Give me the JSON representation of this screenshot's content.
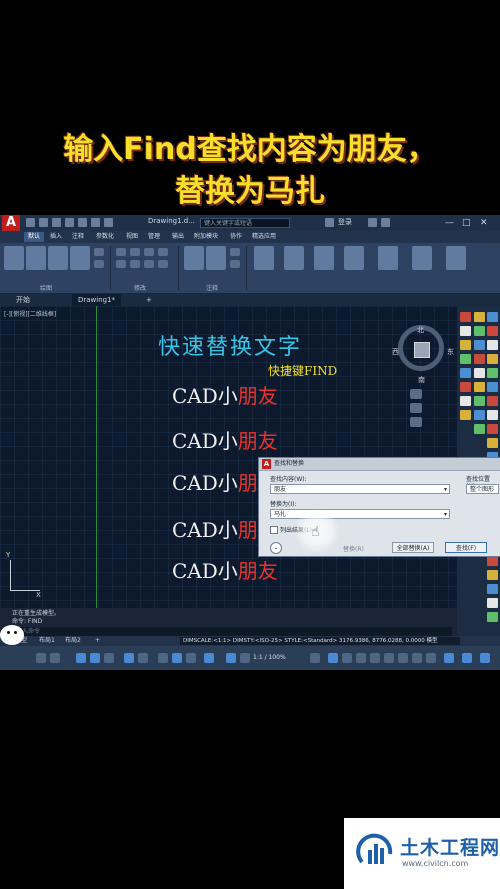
{
  "headline": {
    "line1": "输入Find查找内容为朋友，",
    "line2": "替换为马扎"
  },
  "titlebar": {
    "doc_title": "Drawing1.d...",
    "search_placeholder": "键入关键字或短语",
    "login": "登录",
    "minimize": "—",
    "maximize": "□",
    "close": "✕"
  },
  "menu": [
    "默认",
    "插入",
    "注释",
    "参数化",
    "视图",
    "管理",
    "输出",
    "附加模块",
    "协作",
    "精选应用"
  ],
  "ribbon": {
    "groups": [
      "绘图",
      "修改",
      "注释"
    ]
  },
  "tabs": {
    "start": "开始",
    "drawing": "Drawing1*",
    "add": "+"
  },
  "canvas": {
    "view_label": "[-][俯视][二维线框]",
    "heading": "快速替换文字",
    "subheading": "快捷键FIND",
    "lines": [
      {
        "white": "CAD小",
        "red": "朋友"
      },
      {
        "white": "CAD小",
        "red": "朋友"
      },
      {
        "white": "CAD小",
        "red": "朋"
      },
      {
        "white": "CAD小",
        "red": "朋"
      },
      {
        "white": "CAD小",
        "red": "朋友"
      }
    ],
    "viewcube": {
      "north": "北",
      "south": "南",
      "west": "西",
      "east": "东",
      "top": "上"
    },
    "ucs": {
      "y": "Y",
      "x": "X"
    }
  },
  "dialog": {
    "title": "查找和替换",
    "find_label": "查找内容(W):",
    "find_value": "朋友",
    "replace_label": "替换为(I):",
    "replace_value": "马扎",
    "where_label": "查找位置(H):",
    "where_value": "整个图形",
    "list_results": "列出结果(L)",
    "replace_btn": "替换(R)",
    "replace_all_btn": "全部替换(A)",
    "find_btn": "查找(F)",
    "more": "⌄"
  },
  "command": {
    "history": "正在重生成模型。",
    "prompt": "命令: FIND",
    "input_placeholder": "键入命令"
  },
  "layout_tabs": [
    "模型",
    "布局1",
    "布局2",
    "+"
  ],
  "status": {
    "readout": "DIMSCALE:<1:1> DIMSTY:<ISO-25> STYLE:<Standard>  3176.9386, 8776.0288, 0.0000  模型",
    "scale": "1:1 / 100%"
  },
  "watermark": {
    "name": "土木工程网",
    "url": "www.civilcn.com"
  },
  "colors": {
    "headline": "#f6e02a",
    "cad_heading": "#34c6e8",
    "cad_red": "#e8342c",
    "canvas_bg": "#0d1a2d"
  }
}
